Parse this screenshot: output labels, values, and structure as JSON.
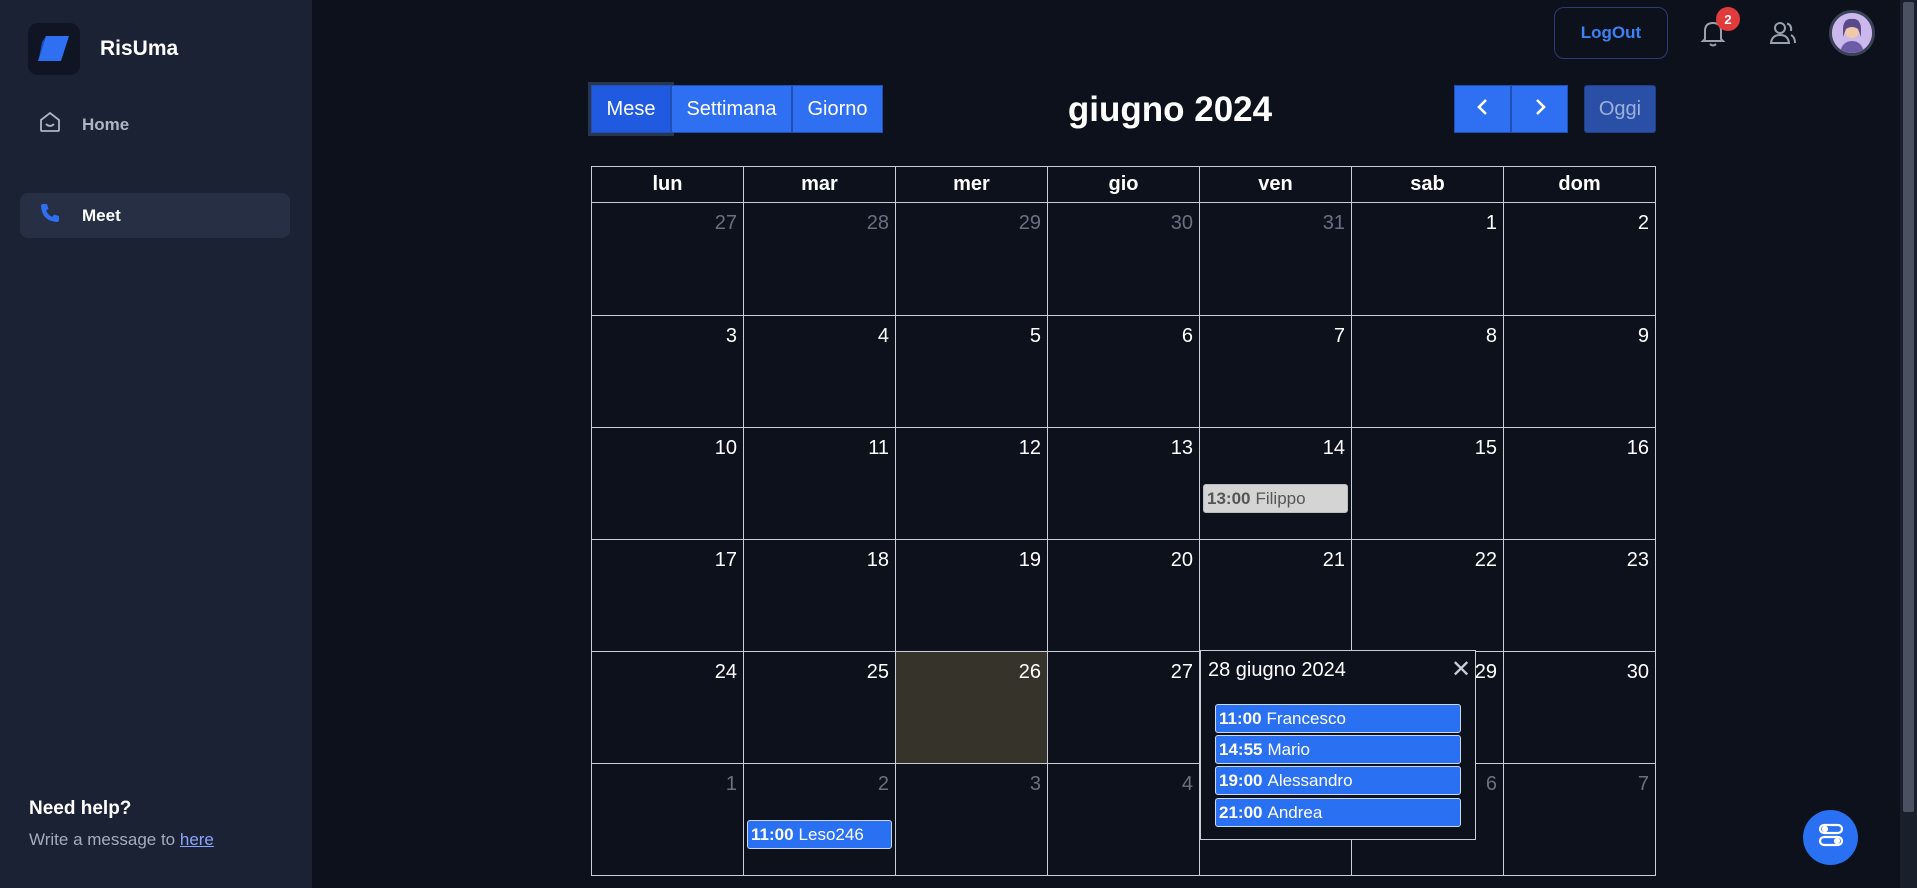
{
  "sidebar": {
    "brand": "RisUma",
    "items": [
      {
        "label": "Home",
        "icon": "home-icon"
      },
      {
        "label": "Meet",
        "icon": "phone-icon"
      }
    ],
    "help_title": "Need help?",
    "help_text": "Write a message to ",
    "help_link": "here"
  },
  "topbar": {
    "logout_label": "LogOut",
    "notification_count": "2"
  },
  "calendar": {
    "views": [
      "Mese",
      "Settimana",
      "Giorno"
    ],
    "active_view": "Mese",
    "title": "giugno 2024",
    "today_label": "Oggi",
    "weekdays": [
      "lun",
      "mar",
      "mer",
      "gio",
      "ven",
      "sab",
      "dom"
    ],
    "weeks": [
      [
        {
          "d": "27",
          "other": true
        },
        {
          "d": "28",
          "other": true
        },
        {
          "d": "29",
          "other": true
        },
        {
          "d": "30",
          "other": true
        },
        {
          "d": "31",
          "other": true
        },
        {
          "d": "1"
        },
        {
          "d": "2"
        }
      ],
      [
        {
          "d": "3"
        },
        {
          "d": "4"
        },
        {
          "d": "5"
        },
        {
          "d": "6"
        },
        {
          "d": "7"
        },
        {
          "d": "8"
        },
        {
          "d": "9"
        }
      ],
      [
        {
          "d": "10"
        },
        {
          "d": "11"
        },
        {
          "d": "12"
        },
        {
          "d": "13"
        },
        {
          "d": "14",
          "event": {
            "time": "13:00",
            "name": "Filippo",
            "style": "grey"
          }
        },
        {
          "d": "15"
        },
        {
          "d": "16"
        }
      ],
      [
        {
          "d": "17"
        },
        {
          "d": "18"
        },
        {
          "d": "19"
        },
        {
          "d": "20"
        },
        {
          "d": "21"
        },
        {
          "d": "22"
        },
        {
          "d": "23"
        }
      ],
      [
        {
          "d": "24"
        },
        {
          "d": "25"
        },
        {
          "d": "26",
          "today": true
        },
        {
          "d": "27"
        },
        {
          "d": "28"
        },
        {
          "d": "29"
        },
        {
          "d": "30"
        }
      ],
      [
        {
          "d": "1",
          "other": true
        },
        {
          "d": "2",
          "other": true,
          "event": {
            "time": "11:00",
            "name": "Leso246",
            "style": "blue"
          }
        },
        {
          "d": "3",
          "other": true
        },
        {
          "d": "4",
          "other": true
        },
        {
          "d": "5",
          "other": true
        },
        {
          "d": "6",
          "other": true
        },
        {
          "d": "7",
          "other": true
        }
      ]
    ],
    "popover": {
      "title": "28 giugno 2024",
      "close": "✕",
      "events": [
        {
          "time": "11:00",
          "name": "Francesco"
        },
        {
          "time": "14:55",
          "name": "Mario"
        },
        {
          "time": "19:00",
          "name": "Alessandro"
        },
        {
          "time": "21:00",
          "name": "Andrea"
        }
      ]
    }
  },
  "colors": {
    "accent": "#2f6ff1",
    "background": "#0d111c",
    "sidebar": "#1b2233",
    "today_cell": "#35332a"
  }
}
